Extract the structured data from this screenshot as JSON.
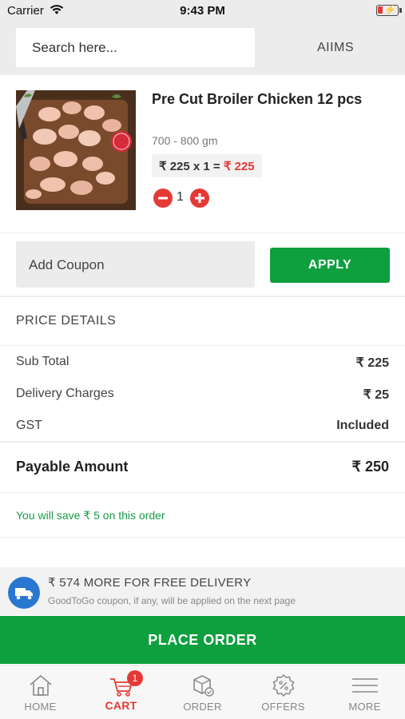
{
  "status_bar": {
    "carrier": "Carrier",
    "time": "9:43 PM"
  },
  "search": {
    "placeholder": "Search here...",
    "location": "AIIMS"
  },
  "product": {
    "name": "Pre Cut Broiler Chicken 12 pcs",
    "weight": "700 - 800 gm",
    "unit_price": "₹ 225 x 1 =",
    "line_total": "₹ 225",
    "quantity": "1"
  },
  "coupon": {
    "placeholder": "Add Coupon",
    "apply_label": "APPLY"
  },
  "price_details": {
    "title": "PRICE DETAILS",
    "sub_total_label": "Sub Total",
    "sub_total_value": "₹ 225",
    "delivery_label": "Delivery Charges",
    "delivery_value": "₹ 25",
    "gst_label": "GST",
    "gst_value": "Included",
    "payable_label": "Payable Amount",
    "payable_value": "₹ 250",
    "savings_text": "You will save ₹ 5 on this order"
  },
  "free_delivery": {
    "title": "₹ 574 MORE FOR FREE DELIVERY",
    "subtitle": "GoodToGo coupon, if any, will be applied on the next page",
    "icon": "truck-icon"
  },
  "place_order_label": "PLACE ORDER",
  "bottom_nav": {
    "items": [
      {
        "label": "HOME",
        "icon": "home-icon"
      },
      {
        "label": "CART",
        "icon": "cart-icon",
        "badge": "1"
      },
      {
        "label": "ORDER",
        "icon": "order-icon"
      },
      {
        "label": "OFFERS",
        "icon": "offers-icon"
      },
      {
        "label": "MORE",
        "icon": "menu-icon"
      }
    ]
  },
  "colors": {
    "brand_green": "#0e9f3e",
    "accent_red": "#e53935",
    "info_blue": "#2977d0"
  }
}
